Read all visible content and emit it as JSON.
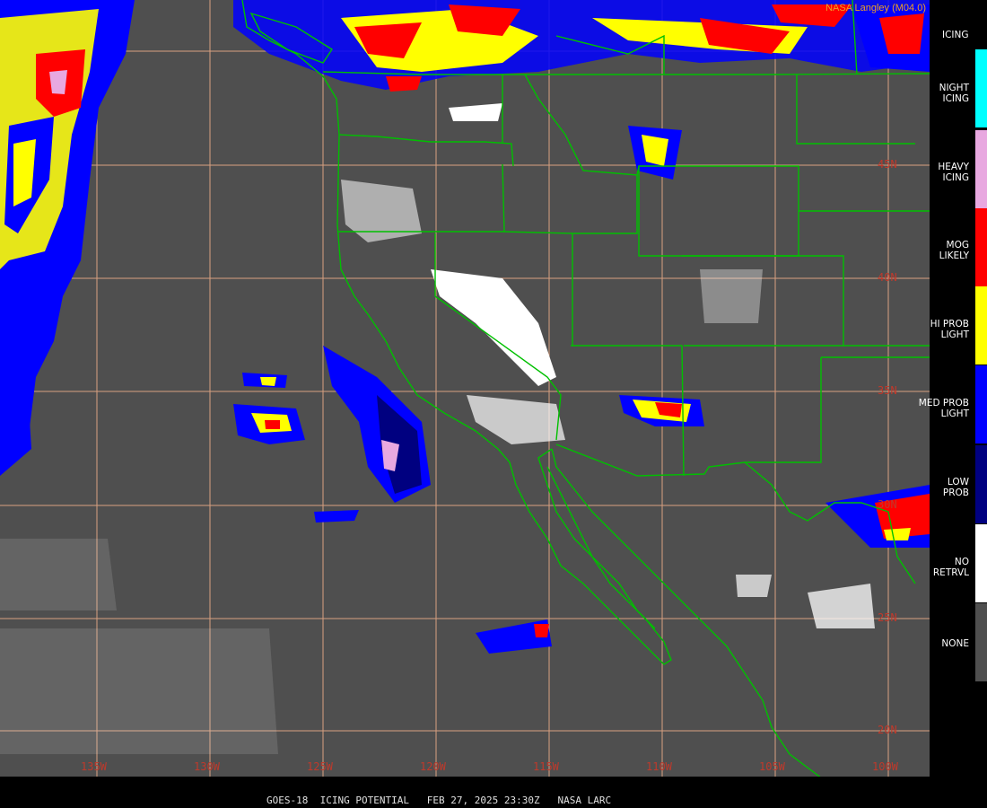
{
  "credit": "NASA Langley (M04.0)",
  "caption": "GOES-18  ICING POTENTIAL   FEB 27, 2025 23:30Z   NASA LARC",
  "legend": {
    "title": "ICING",
    "items": [
      {
        "label": "NIGHT\nICING",
        "color": "#00ffff"
      },
      {
        "label": "HEAVY\nICING",
        "color": "#e8a8e0"
      },
      {
        "label": "MOG\nLIKELY",
        "color": "#ff0000"
      },
      {
        "label": "HI PROB\nLIGHT",
        "color": "#ffff00"
      },
      {
        "label": "MED PROB\nLIGHT",
        "color": "#0000ff"
      },
      {
        "label": "LOW\nPROB",
        "color": "#000080"
      },
      {
        "label": "NO\nRETRVL",
        "color": "#ffffff"
      },
      {
        "label": "NONE",
        "color": "#4f4f4f"
      }
    ]
  },
  "grid": {
    "latitudes": [
      "45N",
      "40N",
      "35N",
      "30N",
      "25N",
      "20N"
    ],
    "longitudes": [
      "135W",
      "130W",
      "125W",
      "120W",
      "115W",
      "110W",
      "105W",
      "100W"
    ],
    "line_color": "#d8a080",
    "label_color": "#c0392b",
    "border_color": "#00c000"
  }
}
